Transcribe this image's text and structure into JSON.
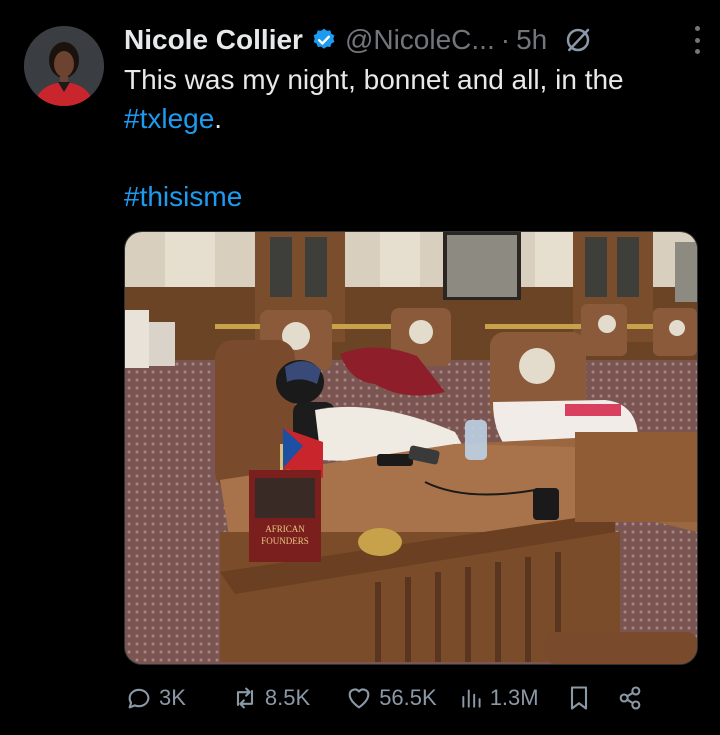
{
  "author": {
    "name": "Nicole Collier",
    "handle": "@NicoleC...",
    "separator": "·",
    "time": "5h"
  },
  "post": {
    "line1_text": "This was my night, bonnet and all, in the ",
    "line1_tag": "#txlege",
    "line1_end": ".",
    "tag2": "#thisisme"
  },
  "book": {
    "line1": "AFRICAN",
    "line2": "FOUNDERS"
  },
  "actions": {
    "replies": "3K",
    "reposts": "8.5K",
    "likes": "56.5K",
    "views": "1.3M"
  },
  "colors": {
    "link": "#1d9bf0",
    "verified": "#1d9bf0",
    "muted": "#71767b"
  },
  "icons": [
    "verified-icon",
    "grok-icon",
    "more-icon",
    "reply-icon",
    "repost-icon",
    "like-icon",
    "views-icon",
    "bookmark-icon",
    "share-icon"
  ]
}
